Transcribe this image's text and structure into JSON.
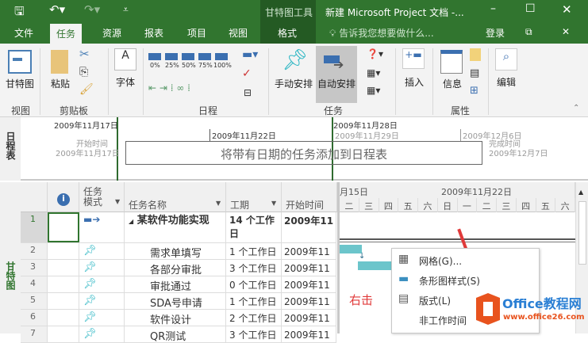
{
  "titlebar": {
    "context_tool": "甘特图工具",
    "title": "新建 Microsoft Project 文档 -...",
    "save_icon": "save-icon",
    "undo_icon": "undo-icon",
    "redo_icon": "redo-icon"
  },
  "tabs": [
    "文件",
    "任务",
    "资源",
    "报表",
    "项目",
    "视图",
    "格式"
  ],
  "tell_me": "告诉我您想要做什么...",
  "login": "登录",
  "ribbon": {
    "view": {
      "button": "甘特图",
      "group": "视图"
    },
    "clipboard": {
      "paste": "粘贴",
      "group": "剪贴板"
    },
    "font": {
      "button": "字体",
      "glyph": "A"
    },
    "schedule": {
      "percents": [
        "0%",
        "25%",
        "50%",
        "75%",
        "100%"
      ],
      "group": "日程"
    },
    "tasks": {
      "manual": "手动安排",
      "auto": "自动安排",
      "group": "任务"
    },
    "insert": {
      "button": "插入"
    },
    "properties": {
      "info": "信息",
      "group": "属性"
    },
    "edit": {
      "button": "编辑"
    }
  },
  "timeline": {
    "label": "日程表",
    "date_left": "2009年11月17日",
    "date_mid": "2009年11月22日",
    "date_right": "2009年11月28日",
    "date_29": "2009年11月29日",
    "date_dec6": "2009年12月6日",
    "start_label": "开始时间",
    "start_date": "2009年11月17日",
    "finish_label": "完成时间",
    "finish_date": "2009年12月7日",
    "placeholder": "将带有日期的任务添加到日程表"
  },
  "gantt": {
    "label": "甘特图",
    "headers": {
      "mode": "任务模式",
      "name": "任务名称",
      "duration": "工期",
      "start": "开始时间"
    },
    "chart_header": {
      "week1": "月15日",
      "week2": "2009年11月22日",
      "days": [
        "二",
        "三",
        "四",
        "五",
        "六",
        "日",
        "一",
        "二",
        "三",
        "四",
        "五",
        "六"
      ]
    },
    "rows": [
      {
        "id": "1",
        "name": "某软件功能实现",
        "duration": "14 个工作日",
        "start": "2009年11"
      },
      {
        "id": "2",
        "name": "需求单填写",
        "duration": "1 个工作日",
        "start": "2009年11"
      },
      {
        "id": "3",
        "name": "各部分审批",
        "duration": "3 个工作日",
        "start": "2009年11"
      },
      {
        "id": "4",
        "name": "审批通过",
        "duration": "0 个工作日",
        "start": "2009年11"
      },
      {
        "id": "5",
        "name": "SDA号申请",
        "duration": "1 个工作日",
        "start": "2009年11"
      },
      {
        "id": "6",
        "name": "软件设计",
        "duration": "2 个工作日",
        "start": "2009年11"
      },
      {
        "id": "7",
        "name": "QR测试",
        "duration": "3 个工作日",
        "start": "2009年11"
      }
    ]
  },
  "annotation": "右击",
  "context_menu": [
    "网格(G)...",
    "条形图样式(S)",
    "版式(L)",
    "非工作时间"
  ],
  "watermark": {
    "brand": "Office教程网",
    "url": "www.office26.com"
  },
  "colors": {
    "green": "#31752f",
    "bar": "#6cc5cb",
    "accent_red": "#e03a3a",
    "office_orange": "#e8531e"
  }
}
